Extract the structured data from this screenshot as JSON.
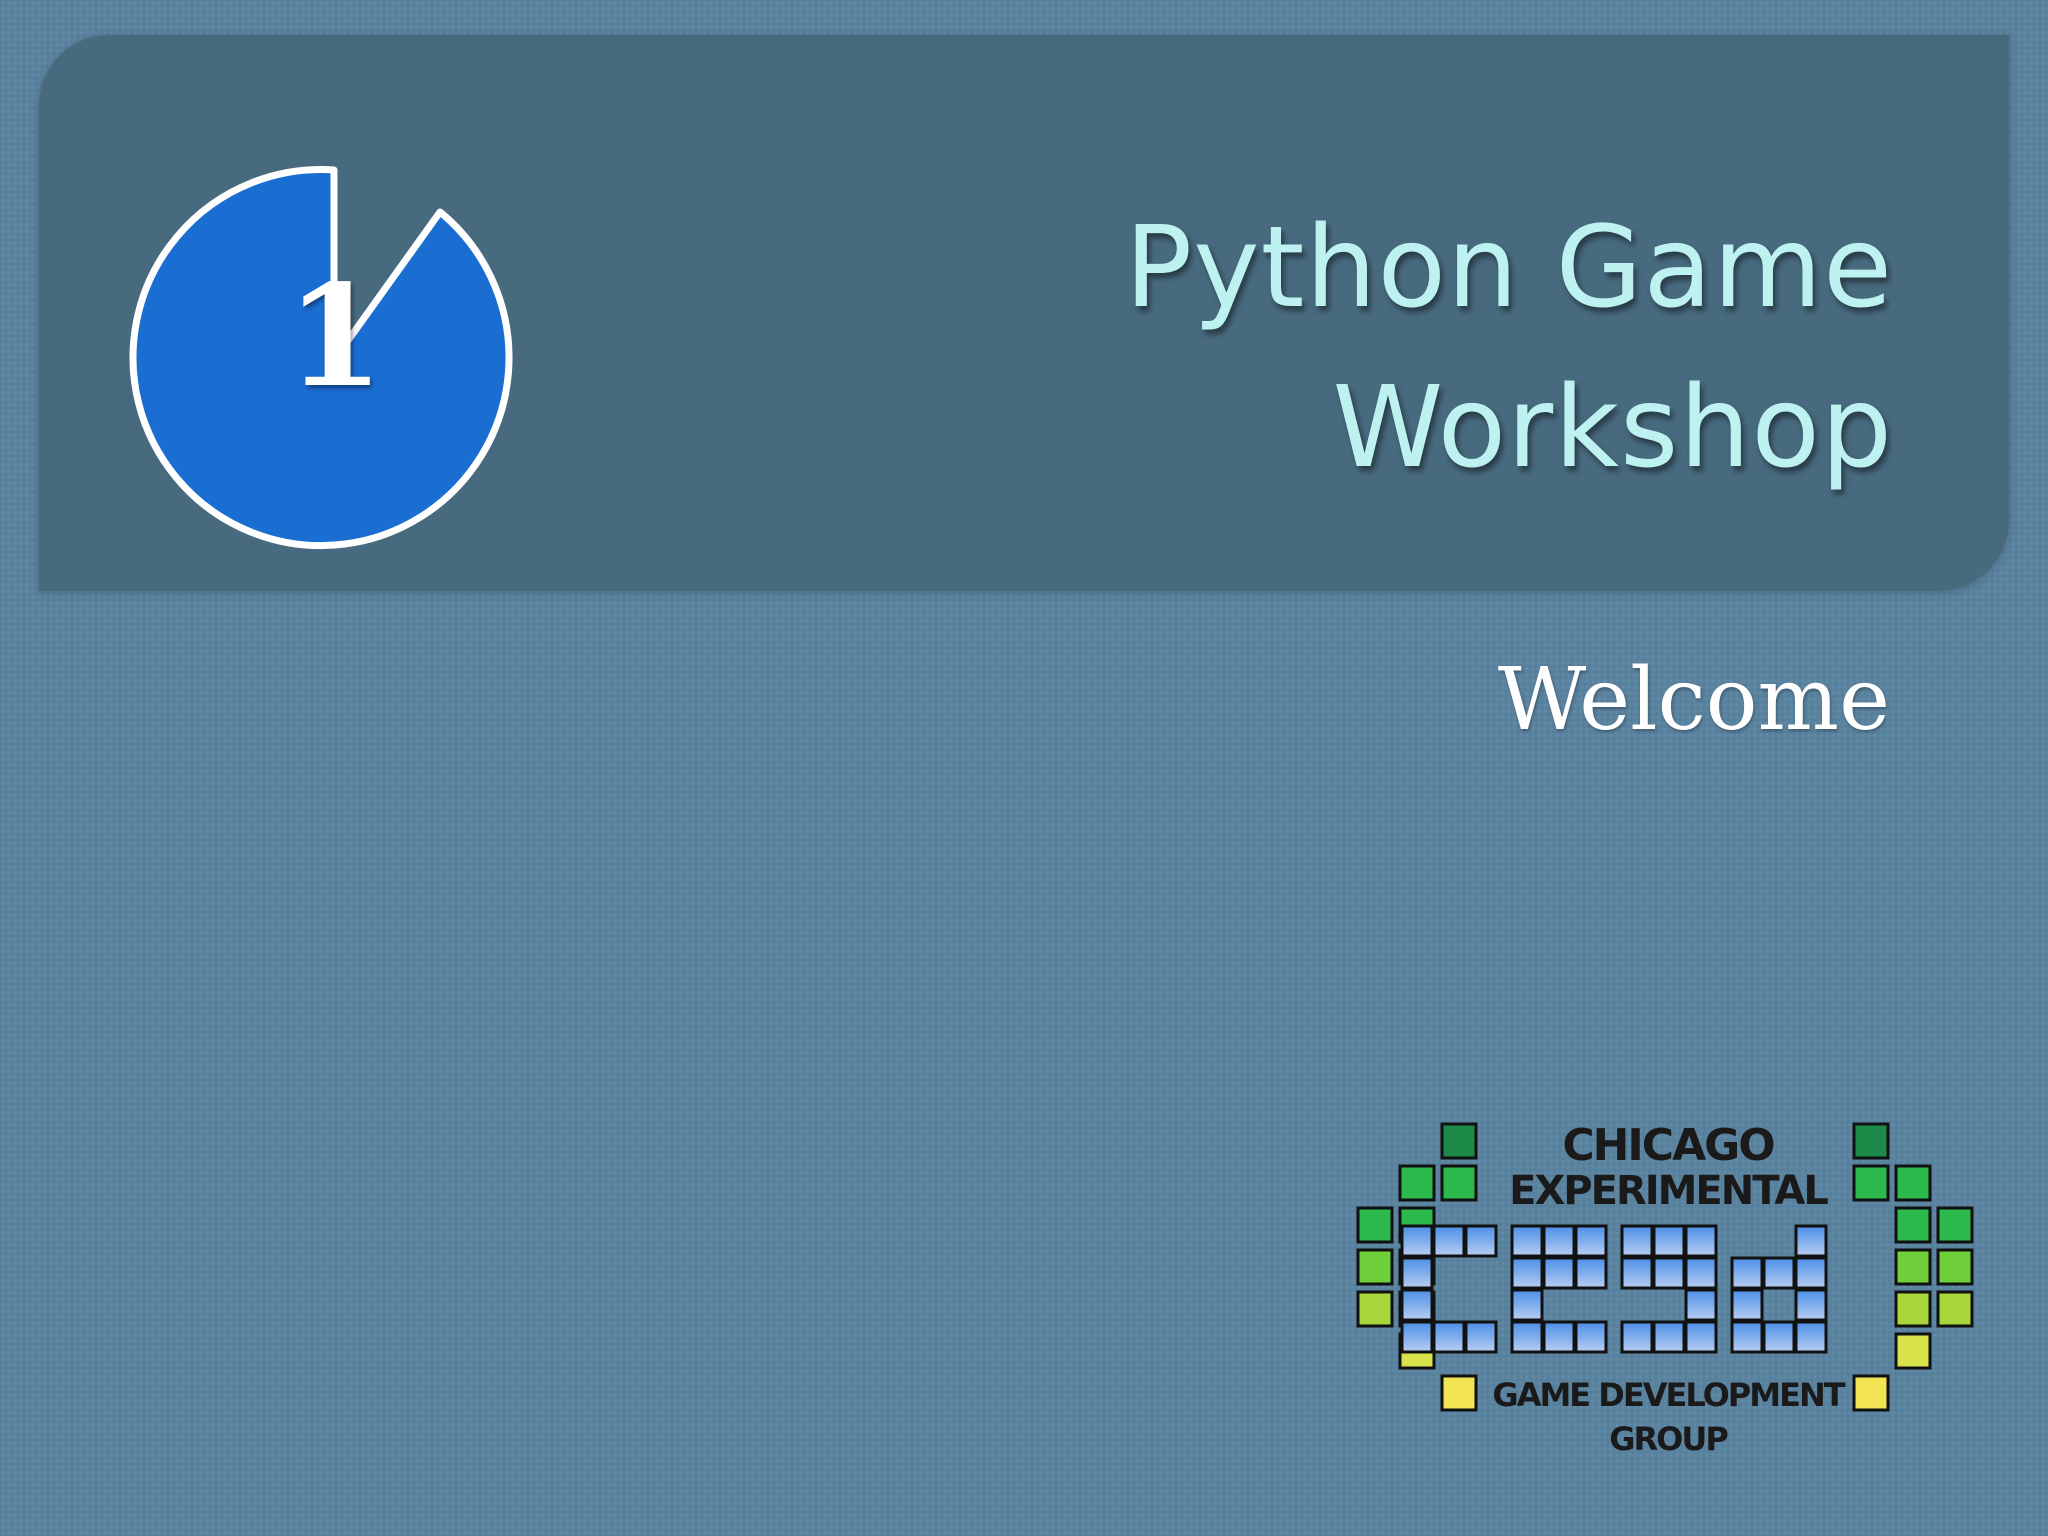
{
  "slide": {
    "chapter_number": "1",
    "title_line1": "Python Game",
    "title_line2": "Workshop",
    "subtitle": "Welcome"
  },
  "logo": {
    "line1": "CHICAGO",
    "line2": "EXPERIMENTAL",
    "acronym": "cegd",
    "line3": "GAME DEVELOPMENT",
    "line4": "GROUP"
  },
  "colors": {
    "background": "#5a83a0",
    "banner": "#486a7f",
    "title": "#bdf2f1",
    "badge_fill": "#1a6dd1",
    "subtitle": "#ffffff"
  }
}
